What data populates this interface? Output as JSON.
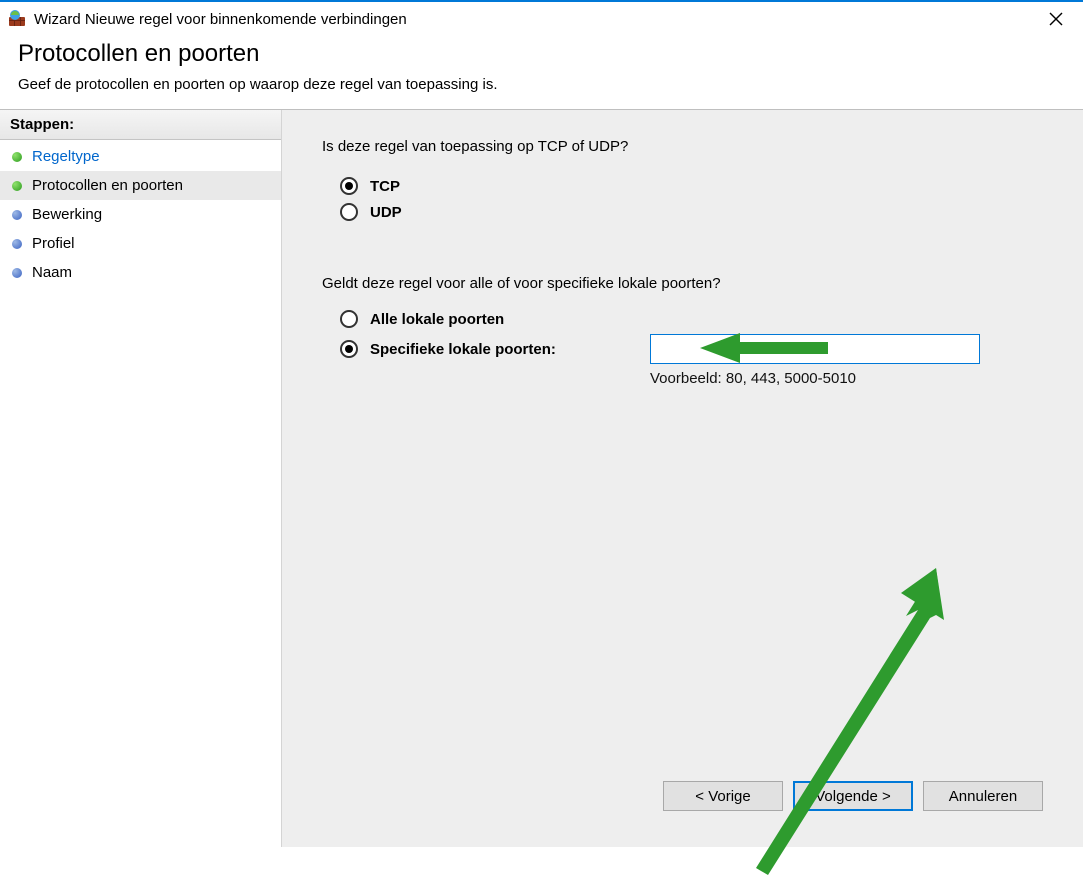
{
  "window": {
    "title": "Wizard Nieuwe regel voor binnenkomende verbindingen"
  },
  "header": {
    "title": "Protocollen en poorten",
    "description": "Geef de protocollen en poorten op waarop deze regel van toepassing is."
  },
  "sidebar": {
    "title": "Stappen:",
    "steps": [
      {
        "label": "Regeltype"
      },
      {
        "label": "Protocollen en poorten"
      },
      {
        "label": "Bewerking"
      },
      {
        "label": "Profiel"
      },
      {
        "label": "Naam"
      }
    ]
  },
  "content": {
    "protocol_question": "Is deze regel van toepassing op TCP of UDP?",
    "protocol_options": {
      "tcp": "TCP",
      "udp": "UDP"
    },
    "ports_question": "Geldt deze regel voor alle of voor specifieke lokale poorten?",
    "port_options": {
      "all": "Alle lokale poorten",
      "specific": "Specifieke lokale poorten:"
    },
    "port_input_value": "",
    "port_example": "Voorbeeld: 80, 443, 5000-5010"
  },
  "buttons": {
    "back": "< Vorige",
    "next": "Volgende >",
    "cancel": "Annuleren"
  }
}
